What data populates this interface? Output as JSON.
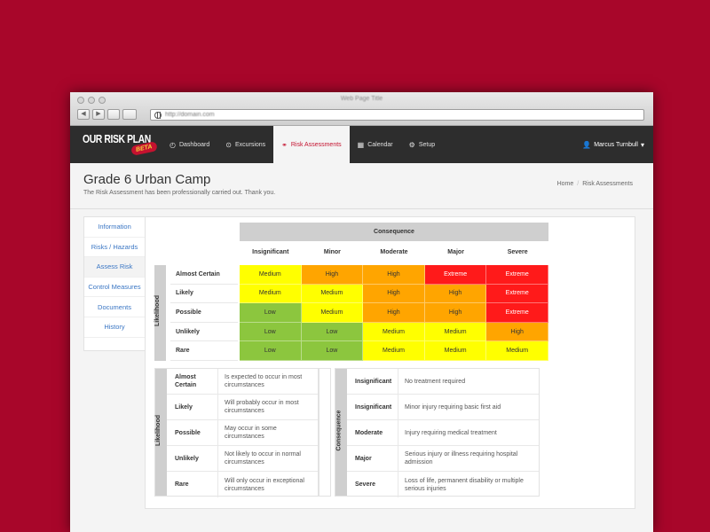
{
  "browser": {
    "window_title": "Web Page Title",
    "url": "http://domain.com"
  },
  "app": {
    "logo": "OUR RISK PLAN",
    "badge": "BETA",
    "nav": [
      {
        "label": "Dashboard",
        "icon": "dashboard-icon"
      },
      {
        "label": "Excursions",
        "icon": "map-marker-icon"
      },
      {
        "label": "Risk Assessments",
        "icon": "link-icon"
      },
      {
        "label": "Calendar",
        "icon": "calendar-icon"
      },
      {
        "label": "Setup",
        "icon": "gear-icon"
      }
    ],
    "active_nav": "Risk Assessments",
    "user": "Marcus Turnbull"
  },
  "page": {
    "title": "Grade 6 Urban Camp",
    "subtitle": "The Risk Assessment has been professionally carried out. Thank you.",
    "breadcrumb": [
      "Home",
      "Risk Assessments"
    ]
  },
  "sidebar": {
    "items": [
      "Information",
      "Risks / Hazards",
      "Assess Risk",
      "Control Measures",
      "Documents",
      "History"
    ],
    "active": "Assess Risk"
  },
  "matrix": {
    "consequence_label": "Consequence",
    "likelihood_label": "Likelihood",
    "columns": [
      "Insignificant",
      "Minor",
      "Moderate",
      "Major",
      "Severe"
    ],
    "rows": [
      {
        "label": "Almost Certain",
        "cells": [
          "Medium",
          "High",
          "High",
          "Extreme",
          "Extreme"
        ]
      },
      {
        "label": "Likely",
        "cells": [
          "Medium",
          "Medium",
          "High",
          "High",
          "Extreme"
        ]
      },
      {
        "label": "Possible",
        "cells": [
          "Low",
          "Medium",
          "High",
          "High",
          "Extreme"
        ]
      },
      {
        "label": "Unlikely",
        "cells": [
          "Low",
          "Low",
          "Medium",
          "Medium",
          "High"
        ]
      },
      {
        "label": "Rare",
        "cells": [
          "Low",
          "Low",
          "Medium",
          "Medium",
          "Medium"
        ]
      }
    ],
    "colors": {
      "Low": "#8cc63e",
      "Medium": "#ffff00",
      "High": "#ffa500",
      "Extreme": "#ff1a1a"
    }
  },
  "likelihood_legend": {
    "label": "Likelihood",
    "rows": [
      {
        "key": "Almost Certain",
        "value": "Is expected to occur in most circumstances"
      },
      {
        "key": "Likely",
        "value": "Will probably occur in most circumstances"
      },
      {
        "key": "Possible",
        "value": "May occur in some circumstances"
      },
      {
        "key": "Unlikely",
        "value": "Not likely to occur in normal circumstances"
      },
      {
        "key": "Rare",
        "value": "Will only occur in exceptional circumstances"
      }
    ]
  },
  "consequence_legend": {
    "label": "Consequence",
    "rows": [
      {
        "key": "Insignificant",
        "value": "No treatment required"
      },
      {
        "key": "Insignificant",
        "value": "Minor injury requiring basic first aid"
      },
      {
        "key": "Moderate",
        "value": "Injury requiring medical treatment"
      },
      {
        "key": "Major",
        "value": "Serious injury or illness requiring hospital admission"
      },
      {
        "key": "Severe",
        "value": "Loss of life, permanent disability or multiple serious injuries"
      }
    ]
  }
}
